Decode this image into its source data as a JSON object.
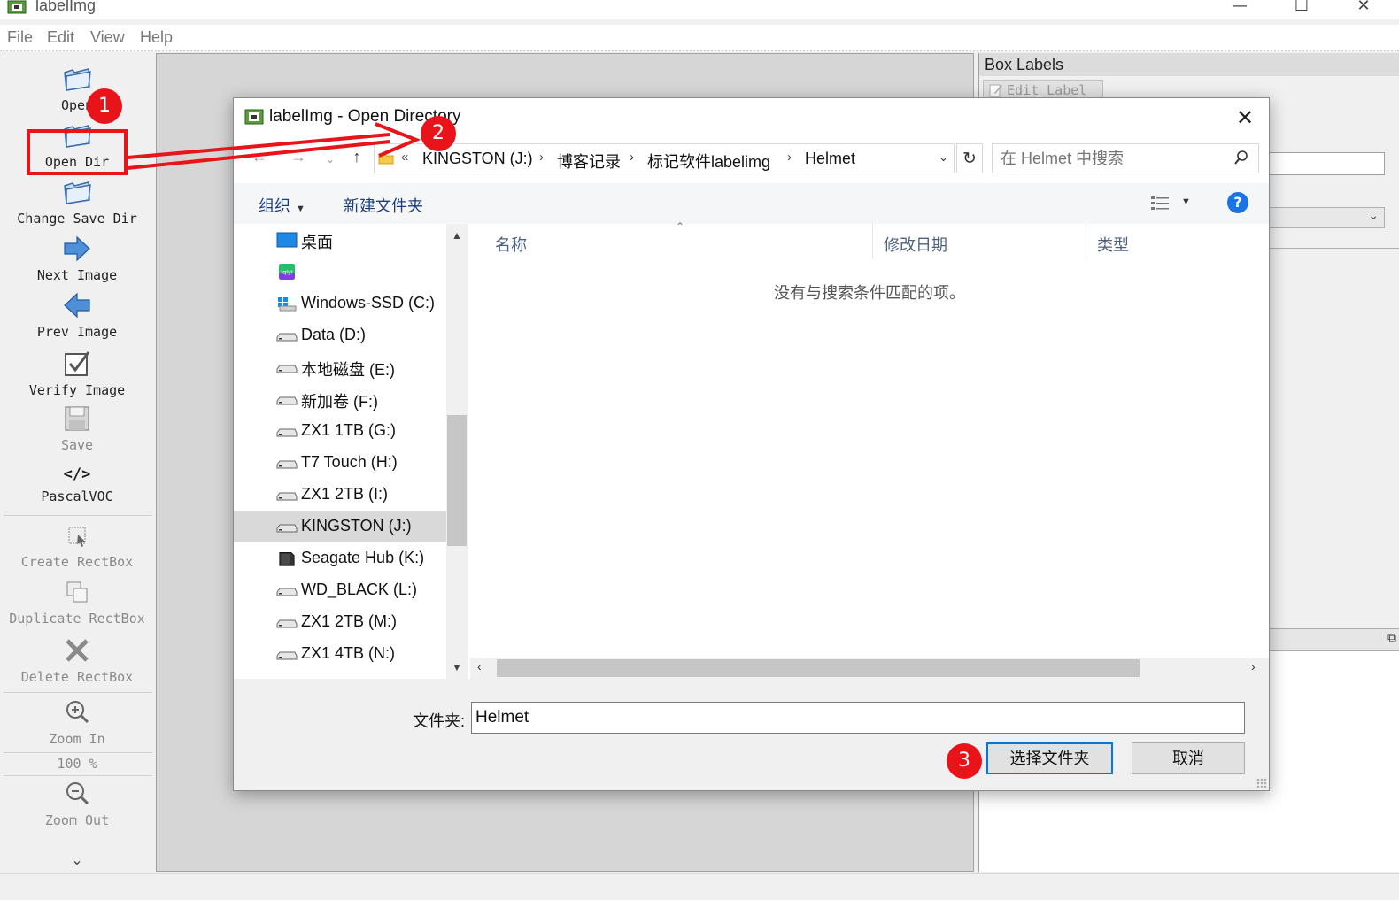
{
  "app": {
    "title": "labelImg",
    "menu": [
      "File",
      "Edit",
      "View",
      "Help"
    ],
    "window_buttons": {
      "minimize": "—",
      "maximize": "☐",
      "close": "✕"
    }
  },
  "toolbar": {
    "open": "Open",
    "open_dir": "Open Dir",
    "change_save_dir": "Change Save Dir",
    "next_image": "Next Image",
    "prev_image": "Prev Image",
    "verify_image": "Verify Image",
    "save": "Save",
    "format": "PascalVOC",
    "format_symbol": "</>",
    "create_rectbox": "Create RectBox",
    "duplicate_rectbox": "Duplicate RectBox",
    "delete_rectbox": "Delete RectBox",
    "zoom_in": "Zoom In",
    "zoom_level": "100 %",
    "zoom_out": "Zoom Out",
    "more": "⌄"
  },
  "dock": {
    "title": "Box Labels",
    "edit_label": "Edit Label"
  },
  "dialog": {
    "title": "labelImg - Open Directory",
    "close": "✕",
    "breadcrumb": [
      "KINGSTON (J:)",
      "博客记录",
      "标记软件labelimg",
      "Helmet"
    ],
    "overflow": "«",
    "search_placeholder": "在 Helmet 中搜索",
    "organize": "组织",
    "new_folder": "新建文件夹",
    "help": "?",
    "tree": [
      {
        "label": "桌面",
        "icon": "desktop-icon"
      },
      {
        "label": "",
        "icon": "iqiyi-icon"
      },
      {
        "label": "Windows-SSD (C:)",
        "icon": "windows-drive-icon"
      },
      {
        "label": "Data (D:)",
        "icon": "drive-icon"
      },
      {
        "label": "本地磁盘 (E:)",
        "icon": "drive-icon"
      },
      {
        "label": "新加卷 (F:)",
        "icon": "drive-icon"
      },
      {
        "label": "ZX1 1TB (G:)",
        "icon": "drive-icon"
      },
      {
        "label": "T7 Touch (H:)",
        "icon": "drive-icon"
      },
      {
        "label": "ZX1 2TB (I:)",
        "icon": "drive-icon"
      },
      {
        "label": "KINGSTON (J:)",
        "icon": "drive-icon",
        "selected": true
      },
      {
        "label": "Seagate Hub (K:)",
        "icon": "external-drive-icon"
      },
      {
        "label": "WD_BLACK (L:)",
        "icon": "drive-icon"
      },
      {
        "label": "ZX1 2TB (M:)",
        "icon": "drive-icon"
      },
      {
        "label": "ZX1 4TB (N:)",
        "icon": "drive-icon"
      }
    ],
    "columns": {
      "name": "名称",
      "modified": "修改日期",
      "type": "类型"
    },
    "empty_message": "没有与搜索条件匹配的项。",
    "folder_label": "文件夹:",
    "folder_value": "Helmet",
    "select_button": "选择文件夹",
    "cancel_button": "取消"
  },
  "annotations": {
    "step1": "1",
    "step2": "2",
    "step3": "3",
    "color": "#e8141a"
  }
}
